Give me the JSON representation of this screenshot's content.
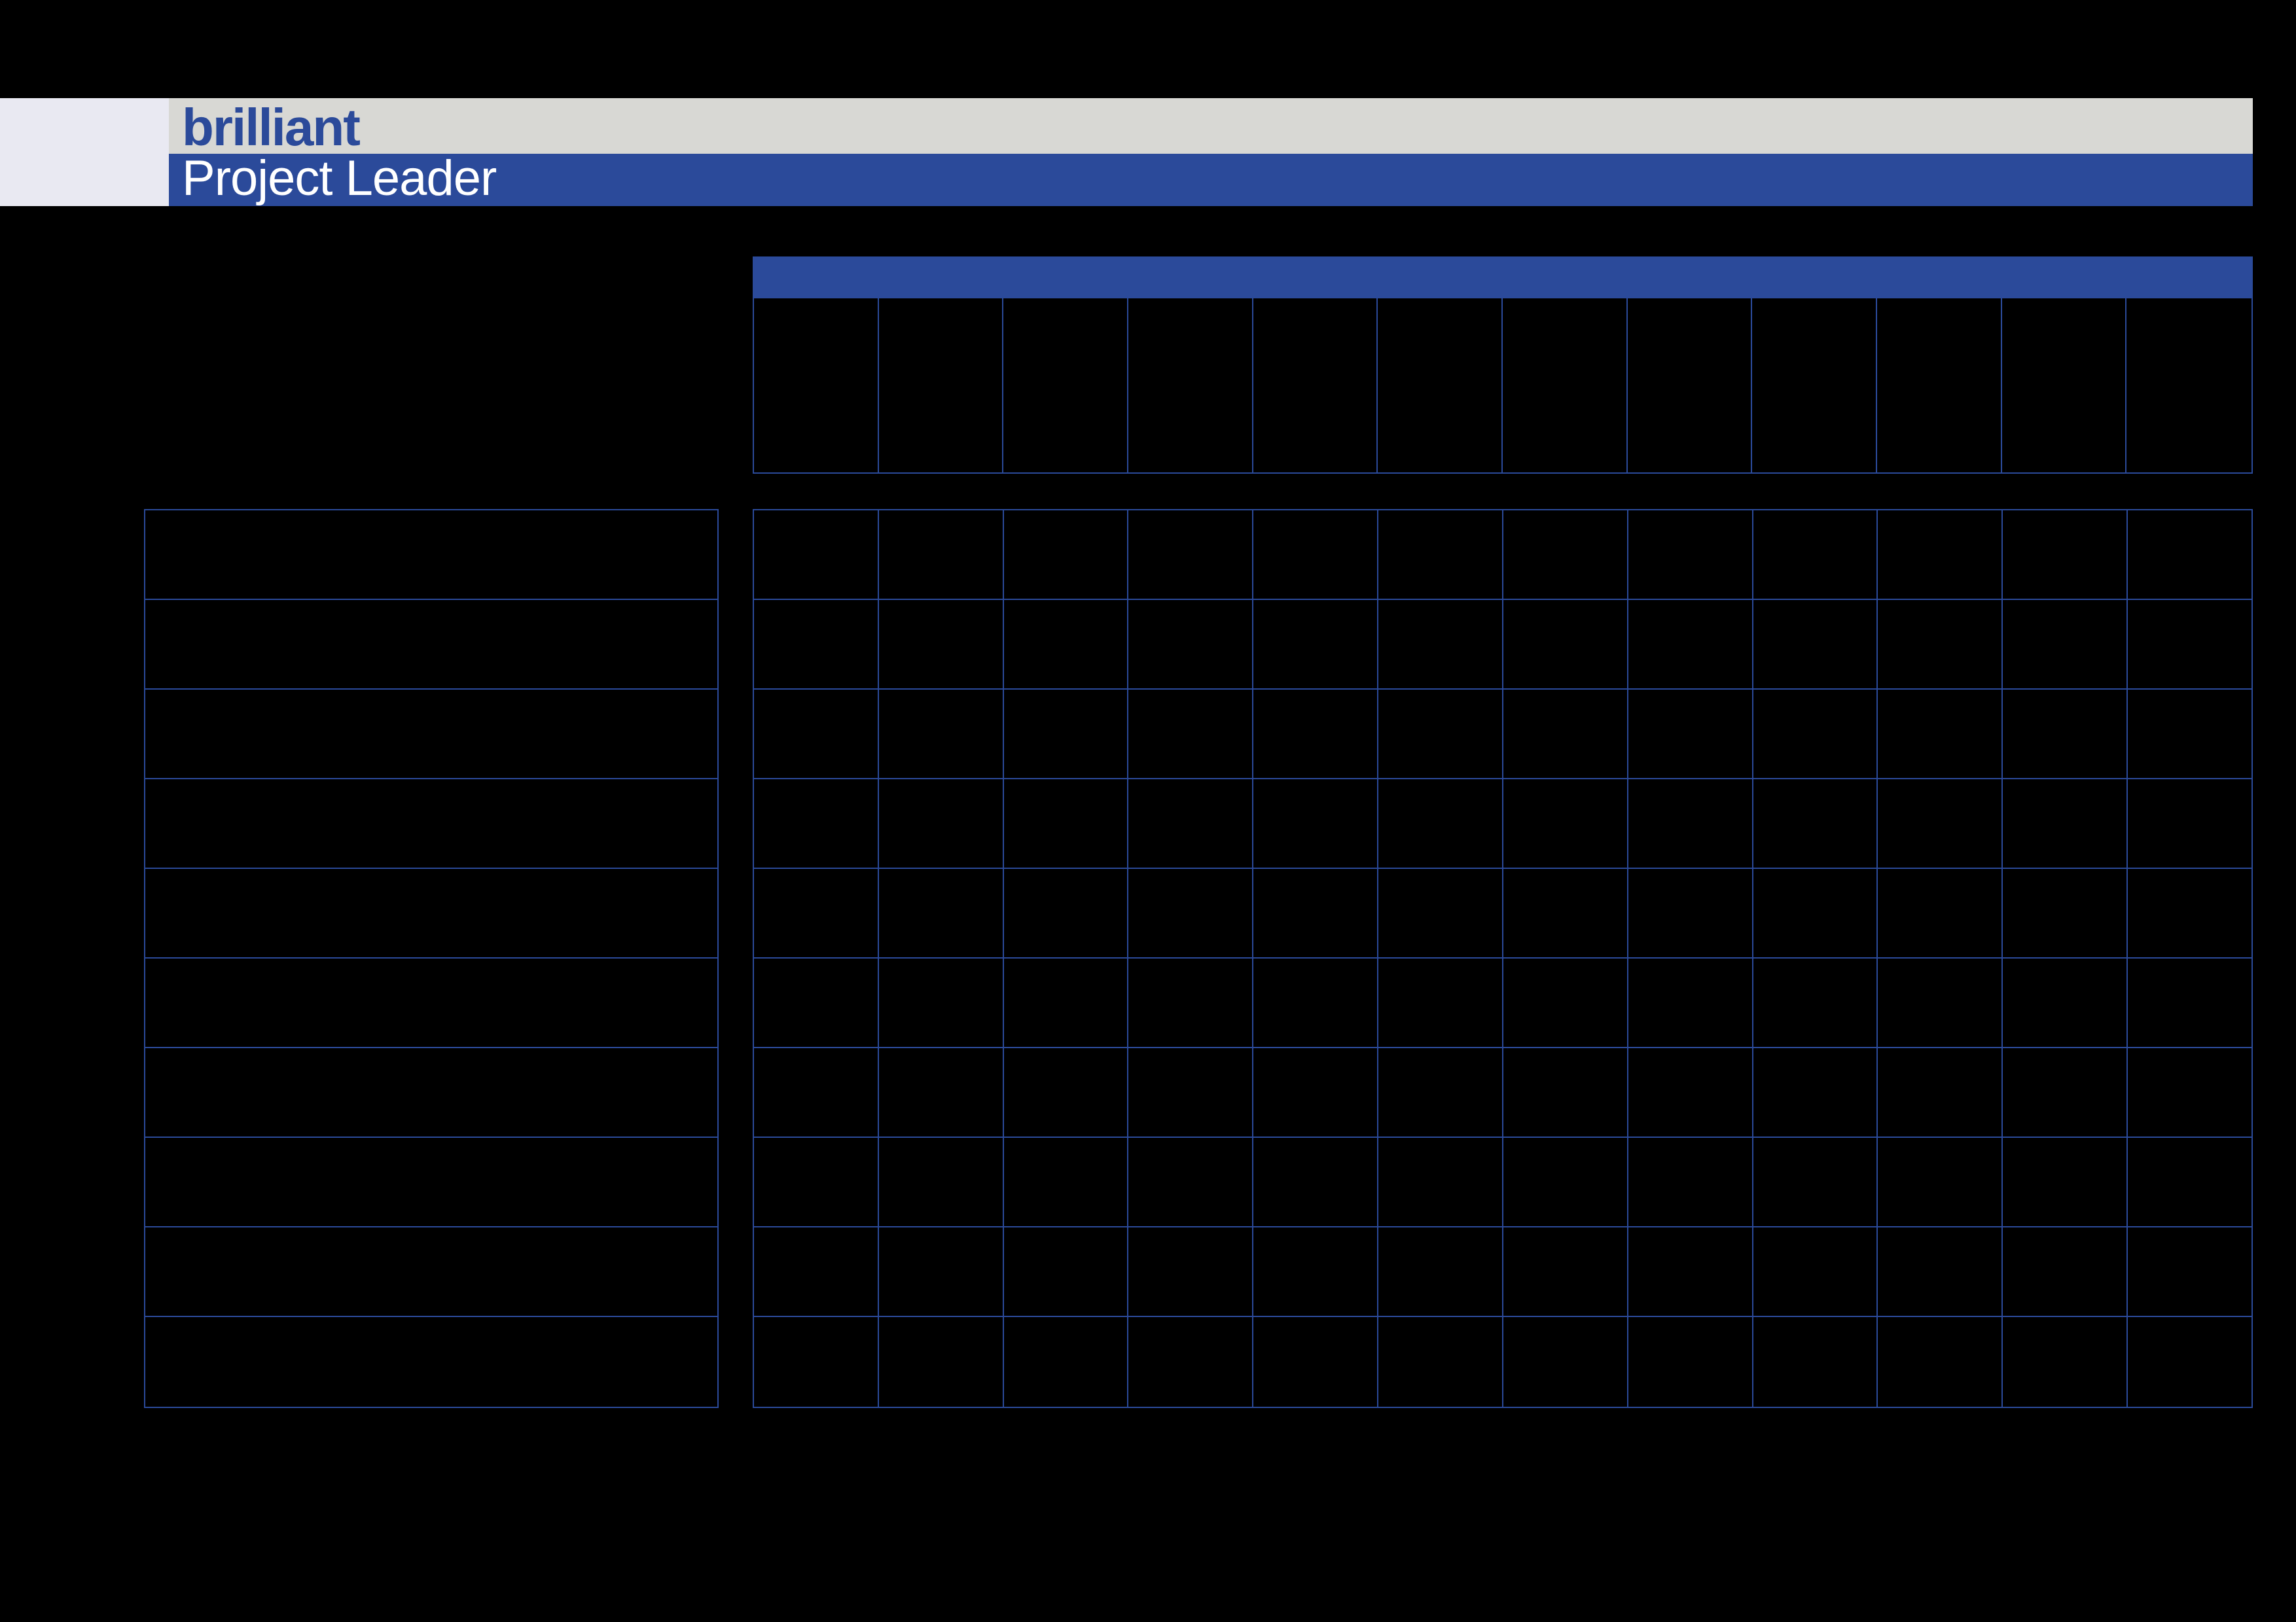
{
  "header": {
    "brand": "brilliant",
    "subtitle": "Project Leader"
  },
  "grid": {
    "columns": 12,
    "leftRows": 10,
    "dataRows": 10,
    "headerCells": [
      "",
      "",
      "",
      "",
      "",
      "",
      "",
      "",
      "",
      "",
      "",
      ""
    ],
    "leftRowsLabels": [
      "",
      "",
      "",
      "",
      "",
      "",
      "",
      "",
      "",
      ""
    ],
    "cells": [
      [
        "",
        "",
        "",
        "",
        "",
        "",
        "",
        "",
        "",
        "",
        "",
        ""
      ],
      [
        "",
        "",
        "",
        "",
        "",
        "",
        "",
        "",
        "",
        "",
        "",
        ""
      ],
      [
        "",
        "",
        "",
        "",
        "",
        "",
        "",
        "",
        "",
        "",
        "",
        ""
      ],
      [
        "",
        "",
        "",
        "",
        "",
        "",
        "",
        "",
        "",
        "",
        "",
        ""
      ],
      [
        "",
        "",
        "",
        "",
        "",
        "",
        "",
        "",
        "",
        "",
        "",
        ""
      ],
      [
        "",
        "",
        "",
        "",
        "",
        "",
        "",
        "",
        "",
        "",
        "",
        ""
      ],
      [
        "",
        "",
        "",
        "",
        "",
        "",
        "",
        "",
        "",
        "",
        "",
        ""
      ],
      [
        "",
        "",
        "",
        "",
        "",
        "",
        "",
        "",
        "",
        "",
        "",
        ""
      ],
      [
        "",
        "",
        "",
        "",
        "",
        "",
        "",
        "",
        "",
        "",
        "",
        ""
      ],
      [
        "",
        "",
        "",
        "",
        "",
        "",
        "",
        "",
        "",
        "",
        "",
        ""
      ]
    ]
  },
  "colors": {
    "primaryBlue": "#2b4a9a",
    "headerGrey": "#d8d8d4",
    "background": "#000000"
  }
}
